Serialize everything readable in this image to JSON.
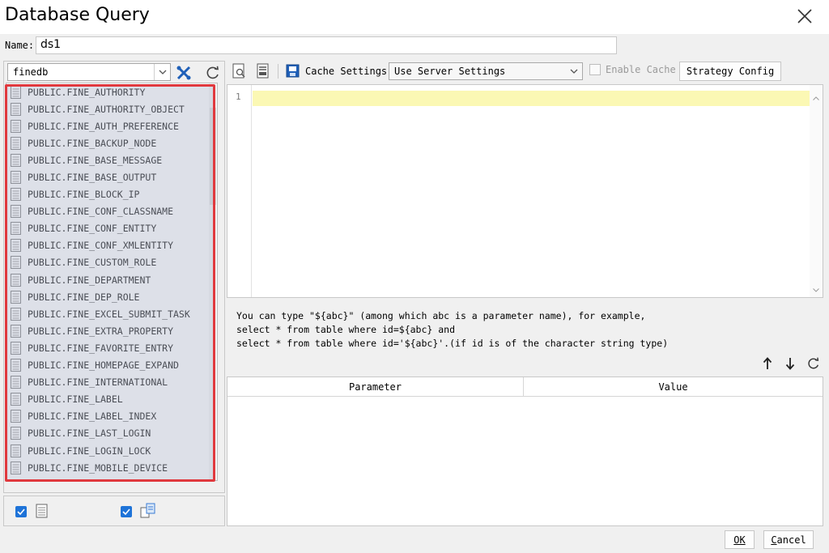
{
  "window": {
    "title": "Database Query",
    "close_icon": "close-icon"
  },
  "name_row": {
    "label": "Name:",
    "value": "ds1"
  },
  "connection": {
    "selected": "finedb",
    "icons": [
      "connection-settings-icon",
      "refresh-icon"
    ]
  },
  "tables": [
    "PUBLIC.FINE_AUTHORITY",
    "PUBLIC.FINE_AUTHORITY_OBJECT",
    "PUBLIC.FINE_AUTH_PREFERENCE",
    "PUBLIC.FINE_BACKUP_NODE",
    "PUBLIC.FINE_BASE_MESSAGE",
    "PUBLIC.FINE_BASE_OUTPUT",
    "PUBLIC.FINE_BLOCK_IP",
    "PUBLIC.FINE_CONF_CLASSNAME",
    "PUBLIC.FINE_CONF_ENTITY",
    "PUBLIC.FINE_CONF_XMLENTITY",
    "PUBLIC.FINE_CUSTOM_ROLE",
    "PUBLIC.FINE_DEPARTMENT",
    "PUBLIC.FINE_DEP_ROLE",
    "PUBLIC.FINE_EXCEL_SUBMIT_TASK",
    "PUBLIC.FINE_EXTRA_PROPERTY",
    "PUBLIC.FINE_FAVORITE_ENTRY",
    "PUBLIC.FINE_HOMEPAGE_EXPAND",
    "PUBLIC.FINE_INTERNATIONAL",
    "PUBLIC.FINE_LABEL",
    "PUBLIC.FINE_LABEL_INDEX",
    "PUBLIC.FINE_LAST_LOGIN",
    "PUBLIC.FINE_LOGIN_LOCK",
    "PUBLIC.FINE_MOBILE_DEVICE"
  ],
  "left_bottom": {
    "table_checkbox_checked": true,
    "view_checkbox_checked": true
  },
  "toolbar": {
    "cache_settings_label": "Cache Settings",
    "cache_mode": "Use Server Settings",
    "enable_cache_label": "Enable Cache",
    "enable_cache_checked": false,
    "strategy_button": "Strategy Config"
  },
  "editor": {
    "line_number": "1",
    "content": ""
  },
  "hint": {
    "line1": "You can type \"${abc}\" (among which abc is a parameter name), for example,",
    "line2": "select * from table where id=${abc} and",
    "line3": "select * from table where id='${abc}'.(if id is of the character string type)"
  },
  "param_table": {
    "col_parameter": "Parameter",
    "col_value": "Value",
    "rows": []
  },
  "buttons": {
    "ok": "OK",
    "cancel_first": "C",
    "cancel_rest": "ancel"
  },
  "colors": {
    "highlight_border": "#e0393e",
    "accent_blue": "#1e73d8",
    "editor_current_line": "#fbf8b4"
  }
}
